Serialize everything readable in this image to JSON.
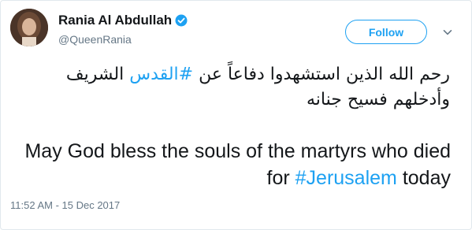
{
  "author": {
    "display_name": "Rania Al Abdullah",
    "handle": "@QueenRania",
    "verified": true
  },
  "actions": {
    "follow_label": "Follow"
  },
  "tweet": {
    "arabic_part1": "رحم الله الذين استشهدوا دفاعاً عن",
    "arabic_hashtag": "#القدس",
    "arabic_part2": "الشريف وأدخلهم فسيح جنانه",
    "english_part1": "May God bless the souls of the martyrs who died for",
    "english_hashtag": "#Jerusalem",
    "english_part2": "today",
    "timestamp": "11:52 AM - 15 Dec 2017"
  },
  "colors": {
    "accent": "#1da1f2",
    "text": "#14171a",
    "muted": "#657786"
  },
  "icons": {
    "verified": "verified-badge-icon",
    "caret": "chevron-down-icon"
  }
}
